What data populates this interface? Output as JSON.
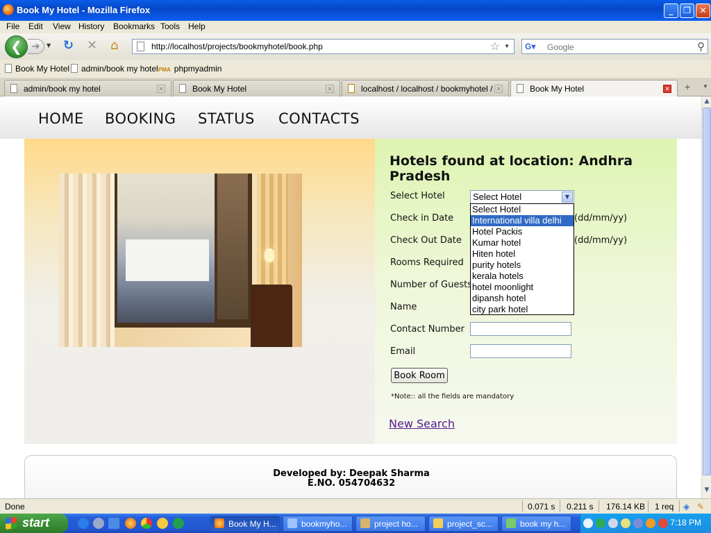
{
  "window": {
    "title": "Book My Hotel - Mozilla Firefox"
  },
  "menu": [
    "File",
    "Edit",
    "View",
    "History",
    "Bookmarks",
    "Tools",
    "Help"
  ],
  "toolbar": {
    "url": "http://localhost/projects/bookmyhotel/book.php",
    "search_placeholder": "Google"
  },
  "bookmarks": [
    "Book My Hotel",
    "admin/book my hotel",
    "phpmyadmin"
  ],
  "tabs": [
    "admin/book my hotel",
    "Book My Hotel",
    "localhost / localhost / bookmyhotel / c...",
    "Book My Hotel"
  ],
  "site": {
    "nav": [
      "HOME",
      "BOOKING",
      "STATUS",
      "CONTACTS"
    ],
    "heading_line1": "Hotels found at location: Andhra",
    "heading_line2": "Pradesh",
    "form": {
      "select_hotel": "Select Hotel",
      "check_in": "Check in Date",
      "check_out": "Check Out Date",
      "rooms": "Rooms Required",
      "guests": "Number of Guests",
      "name": "Name",
      "contact": "Contact Number",
      "email": "Email",
      "date_format": "(dd/mm/yy)",
      "selected_value": "Select Hotel",
      "options": [
        "Select Hotel",
        "International villa delhi",
        "Hotel Packis",
        "Kumar hotel",
        "Hiten hotel",
        "purity hotels",
        "kerala hotels",
        "hotel moonlight",
        "dipansh hotel",
        "city park hotel"
      ],
      "submit": "Book Room",
      "note": "*Note:: all the fields are mandatory",
      "new_search": "New Search"
    },
    "footer": {
      "developer": "Developed by: Deepak Sharma",
      "eno": "E.NO. 054704632"
    }
  },
  "status": {
    "text": "Done",
    "t1": "0.071 s",
    "t2": "0.211 s",
    "size": "176.14 KB",
    "req": "1 req"
  },
  "taskbar": {
    "start": "start",
    "items": [
      "Book My H...",
      "bookmyho...",
      "project ho...",
      "project_sc...",
      "book my h..."
    ],
    "clock": "7:18 PM"
  },
  "colors": {
    "highlight": "#316ac5",
    "link_visited": "#551a8b",
    "title_bar": "#0a5ee8"
  }
}
